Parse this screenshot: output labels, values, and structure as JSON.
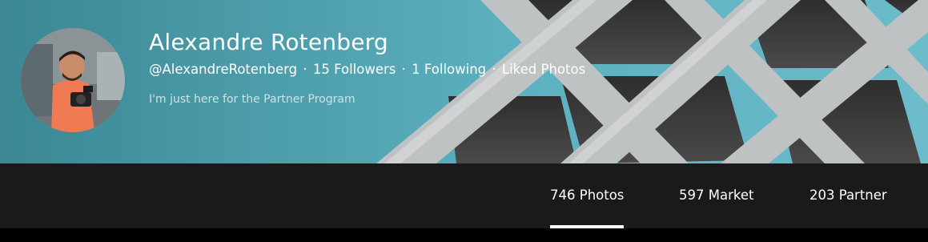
{
  "profile": {
    "name": "Alexandre Rotenberg",
    "handle": "@AlexandreRotenberg",
    "followers": "15 Followers",
    "following": "1 Following",
    "liked": "Liked Photos",
    "bio": "I'm just here for the Partner Program",
    "avatar_icon": "user-avatar-photo"
  },
  "tabs": [
    {
      "label": "746 Photos",
      "active": true
    },
    {
      "label": "597 Market",
      "active": false
    },
    {
      "label": "203 Partner",
      "active": false
    }
  ],
  "colors": {
    "tabbar_bg": "#1a1a1a",
    "hero_teal": "#4a9aa8",
    "text": "#ffffff"
  }
}
